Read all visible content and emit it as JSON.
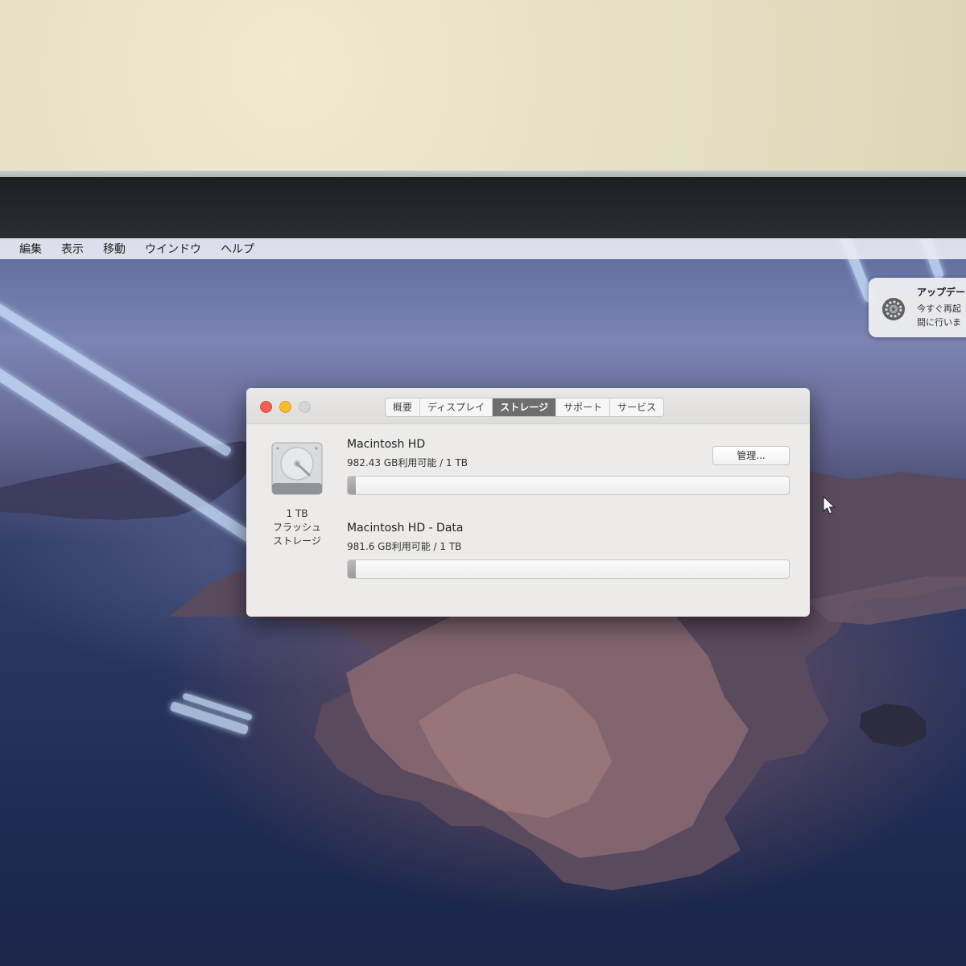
{
  "menubar": {
    "items": [
      {
        "label": "編集"
      },
      {
        "label": "表示"
      },
      {
        "label": "移動"
      },
      {
        "label": "ウインドウ"
      },
      {
        "label": "ヘルプ"
      }
    ]
  },
  "notification": {
    "icon": "gear-icon",
    "title": "アップデー",
    "line1": "今すぐ再起",
    "line2": "間に行いま"
  },
  "window": {
    "traffic_lights": {
      "close": "#f15f57",
      "minimize": "#f7bc2e",
      "zoom": "#d4d4d4"
    },
    "tabs": [
      {
        "label": "概要",
        "active": false
      },
      {
        "label": "ディスプレイ",
        "active": false
      },
      {
        "label": "ストレージ",
        "active": true
      },
      {
        "label": "サポート",
        "active": false
      },
      {
        "label": "サービス",
        "active": false
      }
    ],
    "disk": {
      "icon": "hard-drive-icon",
      "capacity": "1 TB",
      "type_line1": "フラッシュ",
      "type_line2": "ストレージ"
    },
    "volumes": [
      {
        "name": "Macintosh HD",
        "usage": "982.43 GB利用可能 / 1 TB",
        "used_fraction": 0.018
      },
      {
        "name": "Macintosh HD - Data",
        "usage": "981.6 GB利用可能 / 1 TB",
        "used_fraction": 0.018
      }
    ],
    "manage_button": "管理..."
  }
}
